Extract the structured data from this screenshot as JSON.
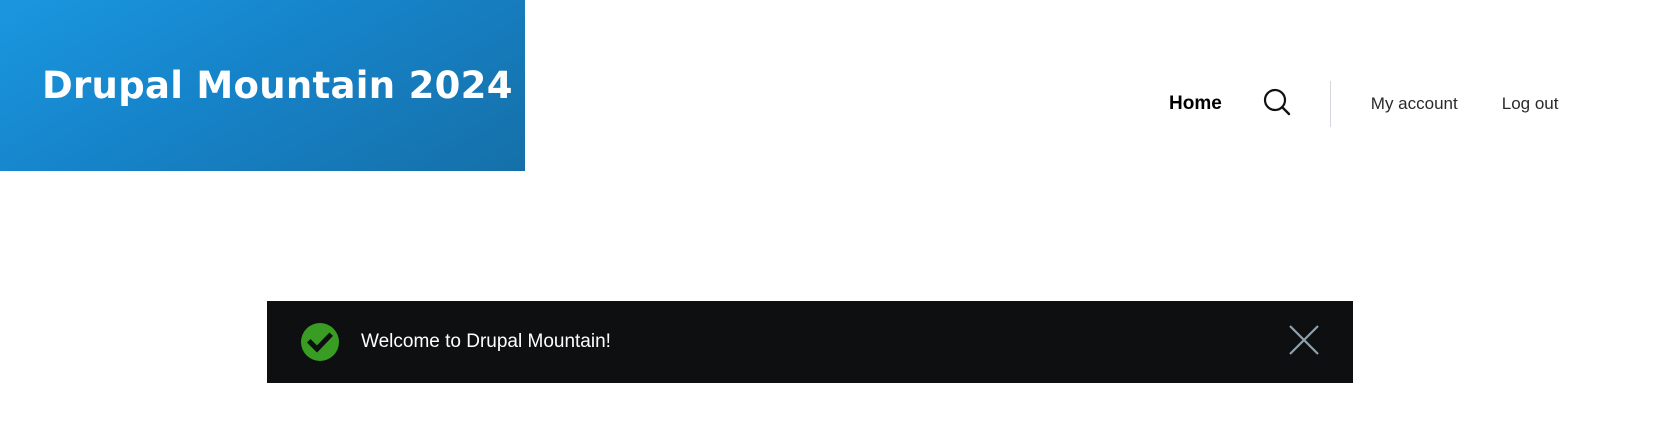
{
  "header": {
    "site_name": "Drupal Mountain 2024",
    "brand_color": "#1683c9",
    "nav": {
      "home_label": "Home",
      "search_icon": "search-icon"
    },
    "account": {
      "my_account_label": "My account",
      "log_out_label": "Log out"
    }
  },
  "message": {
    "type": "status",
    "text": "Welcome to Drupal Mountain!",
    "status_icon": "checkmark-circle-icon",
    "status_color": "#3a9d23",
    "close_icon": "close-icon"
  }
}
